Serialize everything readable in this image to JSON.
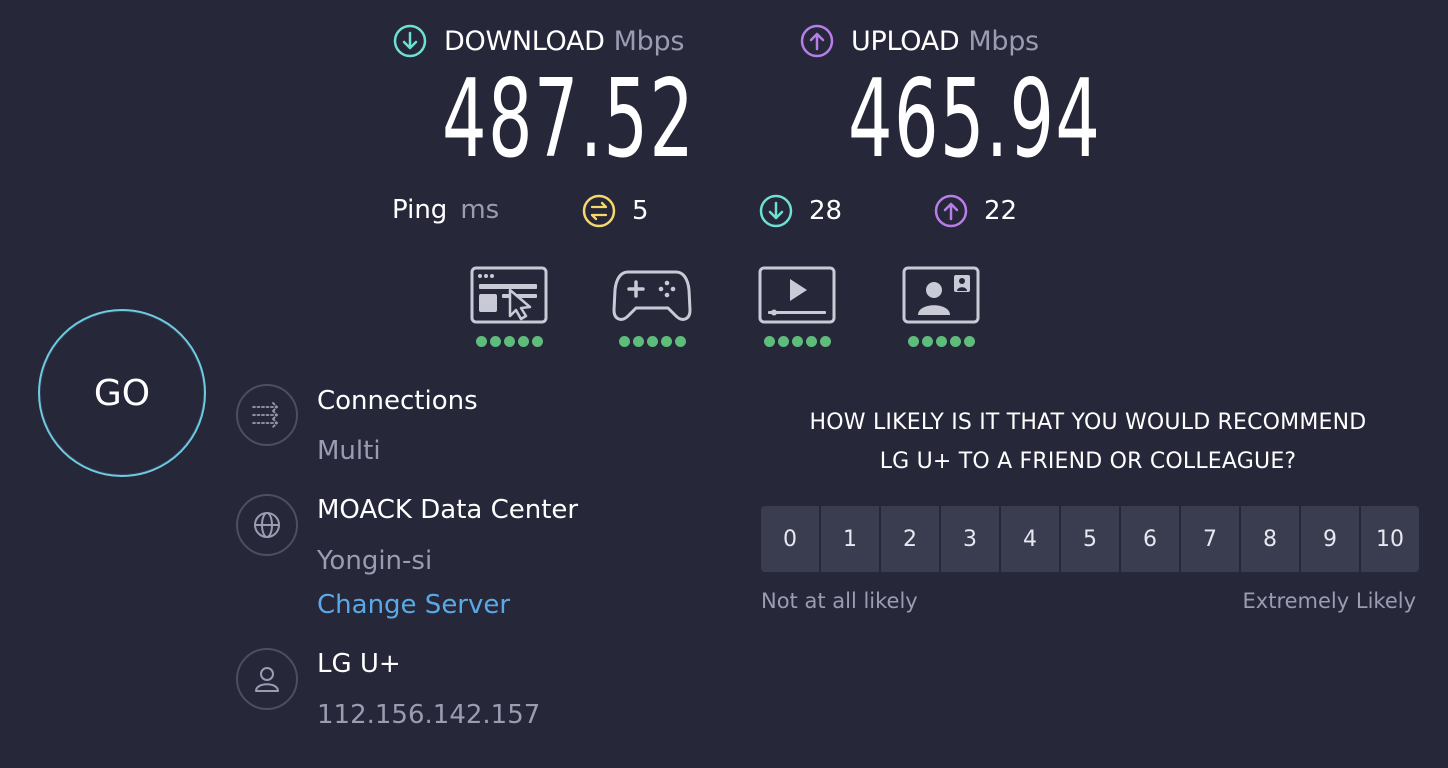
{
  "download": {
    "label": "DOWNLOAD",
    "unit": "Mbps",
    "value": "487.52",
    "color": "#6ee0d2"
  },
  "upload": {
    "label": "UPLOAD",
    "unit": "Mbps",
    "value": "465.94",
    "color": "#b77ee8"
  },
  "ping": {
    "label": "Ping",
    "unit": "ms",
    "idle": "5",
    "download": "28",
    "upload": "22",
    "idle_color": "#f5d76e"
  },
  "activities": [
    {
      "icon": "web-browsing-icon",
      "rating": 5
    },
    {
      "icon": "gaming-controller-icon",
      "rating": 5
    },
    {
      "icon": "video-streaming-icon",
      "rating": 5
    },
    {
      "icon": "video-call-icon",
      "rating": 5
    }
  ],
  "go_label": "GO",
  "connections": {
    "title": "Connections",
    "value": "Multi"
  },
  "server": {
    "title": "MOACK Data Center",
    "location": "Yongin-si",
    "change_label": "Change Server"
  },
  "provider": {
    "title": "LG U+",
    "ip": "112.156.142.157"
  },
  "survey": {
    "question_line1": "HOW LIKELY IS IT THAT YOU WOULD RECOMMEND",
    "question_line2": "LG U+ TO A FRIEND OR COLLEAGUE?",
    "scale": [
      "0",
      "1",
      "2",
      "3",
      "4",
      "5",
      "6",
      "7",
      "8",
      "9",
      "10"
    ],
    "low_label": "Not at all likely",
    "high_label": "Extremely Likely"
  }
}
